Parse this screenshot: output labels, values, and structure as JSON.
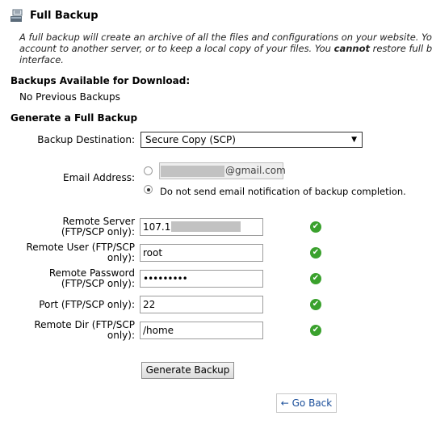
{
  "header": {
    "title": "Full Backup",
    "intro_line1": "A full backup will create an archive of all the files and configurations on your website. You",
    "intro_line2_pre": "account to another server, or to keep a local copy of your files. You ",
    "intro_line2_bold": "cannot",
    "intro_line2_post": " restore full b",
    "intro_line3": "interface."
  },
  "available": {
    "heading": "Backups Available for Download:",
    "empty_text": "No Previous Backups"
  },
  "generate": {
    "heading": "Generate a Full Backup",
    "destination_label": "Backup Destination:",
    "destination_value": "Secure Copy (SCP)",
    "email_label": "Email Address:",
    "email_domain": "@gmail.com",
    "no_notify_text": "Do not send email notification of backup completion.",
    "notify_selected": false
  },
  "remote": {
    "server_label_1": "Remote Server",
    "server_label_2": "(FTP/SCP only):",
    "server_value": "107.1",
    "user_label_1": "Remote User (FTP/SCP",
    "user_label_2": "only):",
    "user_value": "root",
    "password_label_1": "Remote Password",
    "password_label_2": "(FTP/SCP only):",
    "password_value": "•••••••••",
    "port_label": "Port (FTP/SCP only):",
    "port_value": "22",
    "dir_label_1": "Remote Dir (FTP/SCP",
    "dir_label_2": "only):",
    "dir_value": "/home"
  },
  "actions": {
    "generate_label": "Generate Backup",
    "back_label": "← Go Back"
  },
  "icons": {
    "title_icon": "backup-icon",
    "valid_icon": "checkmark-icon"
  },
  "colors": {
    "valid": "#3aa12d",
    "link": "#1a4e9a"
  }
}
